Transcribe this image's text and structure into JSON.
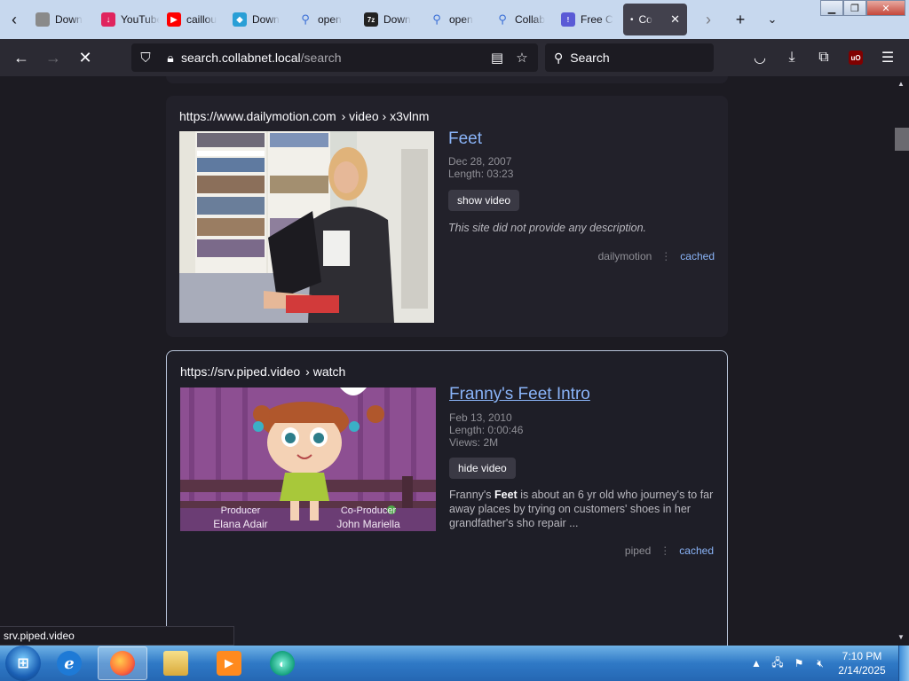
{
  "tabs": [
    {
      "label": "Down",
      "icon": "page-icon",
      "color": "#8a8a8a"
    },
    {
      "label": "YouTube",
      "icon": "download-icon",
      "color": "#e0245e"
    },
    {
      "label": "caillou",
      "icon": "youtube-icon",
      "color": "#ff0000"
    },
    {
      "label": "Down",
      "icon": "diamond-icon",
      "color": "#2a9fd6"
    },
    {
      "label": "open",
      "icon": "search-icon",
      "color": "#3b6fd6"
    },
    {
      "label": "Down",
      "icon": "7zip-icon",
      "color": "#222222"
    },
    {
      "label": "open",
      "icon": "search-icon",
      "color": "#3b6fd6"
    },
    {
      "label": "Collab",
      "icon": "search-icon",
      "color": "#3b6fd6"
    },
    {
      "label": "Free C",
      "icon": "page-icon",
      "color": "#5a5ad6"
    }
  ],
  "active_tab": {
    "label": "Co"
  },
  "nav": {
    "url_host": "search.collabnet.local",
    "url_path": "/search",
    "search_placeholder": "Search"
  },
  "results": [
    {
      "url": "https://www.dailymotion.com",
      "crumb": "› video › x3vlnm",
      "title": "Feet",
      "date": "Dec 28, 2007",
      "length": "Length: 03:23",
      "button": "show video",
      "description": "This site did not provide any description.",
      "engine": "dailymotion",
      "cached": "cached"
    },
    {
      "url": "https://srv.piped.video",
      "crumb": "› watch",
      "title": "Franny's Feet Intro",
      "date": "Feb 13, 2010",
      "length": "Length: 0:00:46",
      "views": "Views: 2M",
      "button": "hide video",
      "description_pre": "Franny's ",
      "description_bold": "Feet",
      "description_post": " is about an 6 yr old who journey's to far away places by trying on customers' shoes in her grandfather's sho repair ...",
      "engine": "piped",
      "cached": "cached",
      "caption_left_1": "Producer",
      "caption_left_2": "Elana Adair",
      "caption_right_1": "Co-Producer",
      "caption_right_2": "John Mariella"
    }
  ],
  "status_url": "srv.piped.video",
  "taskbar": {
    "time": "7:10 PM",
    "date": "2/14/2025"
  }
}
